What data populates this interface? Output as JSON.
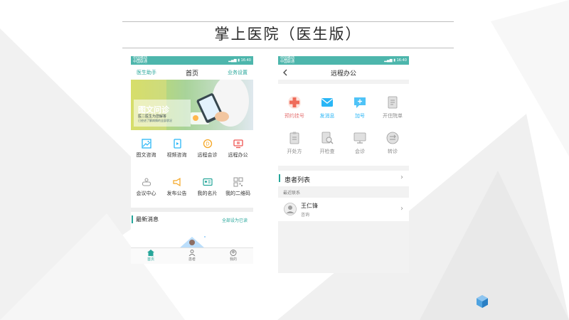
{
  "slide": {
    "title": "掌上医院（医生版）"
  },
  "left_phone": {
    "status_left": [
      "中国移动",
      "中国联通"
    ],
    "status_time": "16:40",
    "nav": {
      "left_link": "医生助手",
      "title": "首页",
      "right_link": "业务设置"
    },
    "banner": {
      "title": "图文问诊",
      "subtitle": "医二医生为您解答",
      "caption": "已经进了解病情的全部状况"
    },
    "grid": [
      {
        "label": "图文咨询",
        "icon": "image-icon"
      },
      {
        "label": "视频咨询",
        "icon": "video-icon"
      },
      {
        "label": "远程会诊",
        "icon": "coin-icon"
      },
      {
        "label": "远程办公",
        "icon": "monitor-icon"
      },
      {
        "label": "会议中心",
        "icon": "meeting-icon"
      },
      {
        "label": "发布公告",
        "icon": "megaphone-icon"
      },
      {
        "label": "我的名片",
        "icon": "card-icon"
      },
      {
        "label": "我的二维码",
        "icon": "qrcode-icon"
      }
    ],
    "news": {
      "title": "最新消息",
      "action": "全部设为已读"
    },
    "tabs": [
      {
        "label": "首页",
        "icon": "home-icon",
        "active": true
      },
      {
        "label": "患者",
        "icon": "patient-icon",
        "active": false
      },
      {
        "label": "我的",
        "icon": "profile-icon",
        "active": false
      }
    ]
  },
  "right_phone": {
    "status_left": [
      "中国移动",
      "中国联通"
    ],
    "status_time": "16:40",
    "nav": {
      "title": "远程办公"
    },
    "grid": [
      {
        "label": "预约挂号",
        "icon": "cross-icon",
        "color": "#ef6c5a"
      },
      {
        "label": "发消息",
        "icon": "mail-icon",
        "color": "#29b6f6"
      },
      {
        "label": "加号",
        "icon": "chat-plus-icon",
        "color": "#29b6f6"
      },
      {
        "label": "开住院单",
        "icon": "document-icon",
        "color": "#9e9e9e"
      },
      {
        "label": "开处方",
        "icon": "clipboard-icon",
        "color": "#9e9e9e"
      },
      {
        "label": "开检查",
        "icon": "exam-icon",
        "color": "#9e9e9e"
      },
      {
        "label": "会诊",
        "icon": "screen-icon",
        "color": "#9e9e9e"
      },
      {
        "label": "转诊",
        "icon": "transfer-icon",
        "color": "#9e9e9e"
      }
    ],
    "patients": {
      "title": "患者列表"
    },
    "recent": {
      "caption": "最近联系"
    },
    "contact": {
      "name": "王仁锋",
      "sub": "咨询"
    }
  },
  "colors": {
    "accent": "#26a69a",
    "statusbar": "#4db6ac"
  }
}
